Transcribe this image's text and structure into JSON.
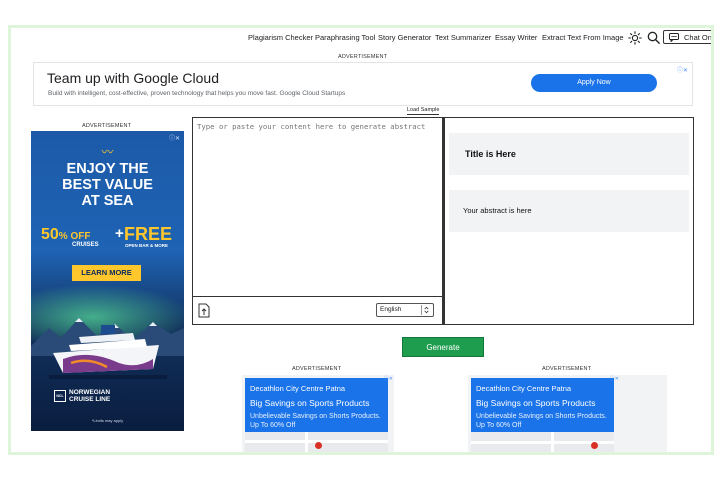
{
  "nav": {
    "links": [
      "Plagiarism Checker",
      "Paraphrasing Tool",
      "Story Generator",
      "Text Summarizer",
      "Essay Writer",
      "Extract Text From Image"
    ],
    "chat_label": "Chat Onl"
  },
  "ad_label": "ADVERTISEMENT",
  "banner_ad": {
    "title": "Team up with Google Cloud",
    "subtitle": "Build with intelligent, cost-effective, proven technology that helps you move fast. Google Cloud Startups",
    "button": "Apply Now",
    "adchoice": "ⓘ✕"
  },
  "load_sample": "Load Sample",
  "side_ad": {
    "wave": "〰",
    "headline": [
      "ENJOY THE",
      "BEST VALUE",
      "AT SEA"
    ],
    "off": "50",
    "off_suffix": "% OFF",
    "cruises": "CRUISES",
    "plus": "+",
    "free": "FREE",
    "open_bar": "OPEN BAR & MORE",
    "button": "LEARN MORE",
    "brand_line1": "NORWEGIAN",
    "brand_line2": "CRUISE LINE",
    "brand_mark": "NCL",
    "terms": "*Limits may apply",
    "colors": {
      "accent": "#ffc72c",
      "navy": "#0a2a5c"
    }
  },
  "editor": {
    "placeholder": "Type or paste your content here to generate abstract",
    "language": "English"
  },
  "output": {
    "title": "Title is Here",
    "abstract": "Your abstract is here"
  },
  "generate_label": "Generate",
  "mini_ads": [
    {
      "brand": "Decathlon City Centre Patna",
      "headline": "Big Savings on Sports Products",
      "text": "Unbelievable Savings on Shorts Products. Up To 60% Off"
    },
    {
      "brand": "Decathlon City Centre Patna",
      "headline": "Big Savings on Sports Products",
      "text": "Unbelievable Savings on Shorts Products. Up To 60% Off"
    }
  ],
  "colors": {
    "frame": "#dff5d9",
    "generate": "#1e9d4f",
    "apply": "#1a73e8"
  }
}
